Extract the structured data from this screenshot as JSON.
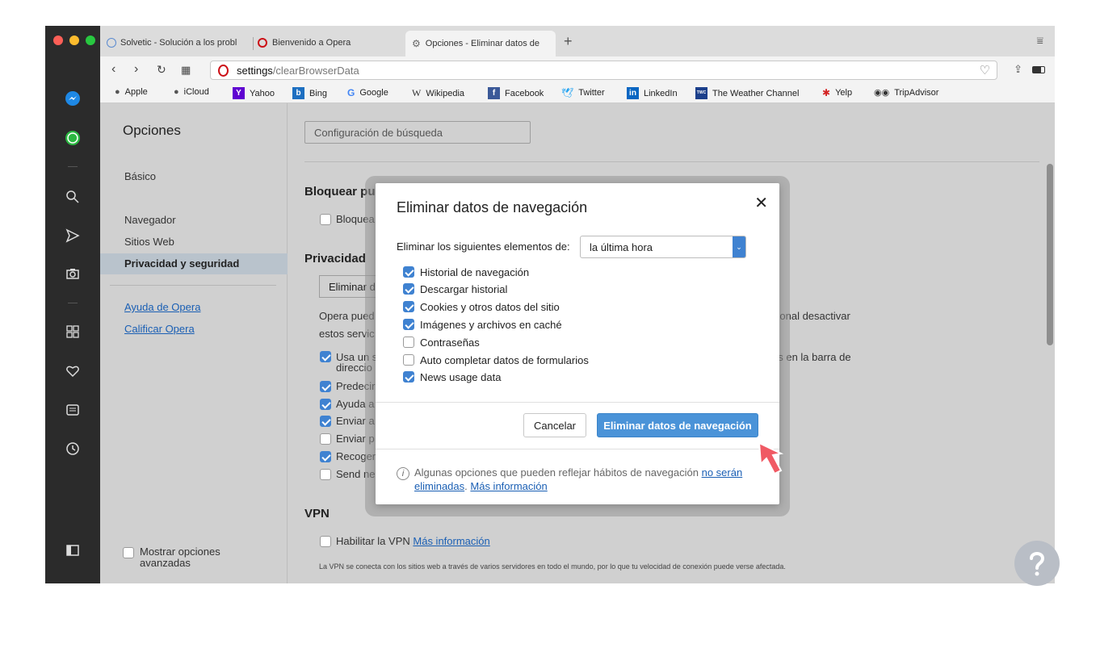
{
  "tabs": [
    {
      "label": "Solvetic - Solución a los probl"
    },
    {
      "label": "Bienvenido a Opera"
    },
    {
      "label": "Opciones - Eliminar datos de"
    }
  ],
  "address": {
    "host": "settings",
    "path": "/clearBrowserData"
  },
  "bookmarks": [
    "Apple",
    "iCloud",
    "Yahoo",
    "Bing",
    "Google",
    "Wikipedia",
    "Facebook",
    "Twitter",
    "LinkedIn",
    "The Weather Channel",
    "Yelp",
    "TripAdvisor"
  ],
  "sidebar_icons": [
    "messenger-icon",
    "whatsapp-icon",
    "search-icon",
    "send-icon",
    "camera-icon",
    "speed-dial-icon",
    "heart-icon",
    "news-icon",
    "history-icon",
    "sidebar-toggle-icon"
  ],
  "settings": {
    "title": "Opciones",
    "nav": {
      "basic": "Básico",
      "browser": "Navegador",
      "websites": "Sitios Web",
      "privacy": "Privacidad y seguridad",
      "help": "Ayuda de Opera",
      "rate": "Calificar Opera",
      "advanced": "Mostrar opciones avanzadas"
    },
    "search_config": "Configuración de búsqueda",
    "block_title": "Bloquear pu",
    "block_item": "Bloquea",
    "privacy_title": "Privacidad",
    "clear_btn": "Eliminar d",
    "privacy_text1": "Opera pued",
    "privacy_text1_end": "cional desactivar",
    "privacy_text2": "estos servic",
    "privacy_items": [
      {
        "label": "Usa un s",
        "checked": true
      },
      {
        "label": "direccio",
        "checked": null
      },
      {
        "label": "Predecir",
        "checked": true
      },
      {
        "label": "Ayuda a",
        "checked": true
      },
      {
        "label": "Enviar a",
        "checked": true
      },
      {
        "label": "Enviar p",
        "checked": false
      },
      {
        "label": "Recoger",
        "checked": true
      },
      {
        "label": "Send ne",
        "checked": false
      }
    ],
    "privacy_item_end": "as en la barra de",
    "vpn_title": "VPN",
    "vpn_label": "Habilitar la VPN",
    "vpn_link": "Más información",
    "vpn_desc": "La VPN se conecta con los sitios web a través de varios servidores en todo el mundo, por lo que tu velocidad de conexión puede verse afectada."
  },
  "dialog": {
    "title": "Eliminar datos de navegación",
    "range_label": "Eliminar los siguientes elementos de:",
    "range_value": "la última hora",
    "items": [
      {
        "label": "Historial de navegación",
        "checked": true
      },
      {
        "label": "Descargar historial",
        "checked": true
      },
      {
        "label": "Cookies y otros datos del sitio",
        "checked": true
      },
      {
        "label": "Imágenes y archivos en caché",
        "checked": true
      },
      {
        "label": "Contraseñas",
        "checked": false
      },
      {
        "label": "Auto completar datos de formularios",
        "checked": false
      },
      {
        "label": "News usage data",
        "checked": true
      }
    ],
    "cancel": "Cancelar",
    "confirm": "Eliminar datos de navegación",
    "info_text": "Algunas opciones que pueden reflejar hábitos de navegación",
    "info_link1": "no serán eliminadas",
    "info_link2": "Más información"
  },
  "colors": {
    "accent": "#4a93d8",
    "sidebar": "#2b2b2b",
    "opera_red": "#cc0f16"
  }
}
